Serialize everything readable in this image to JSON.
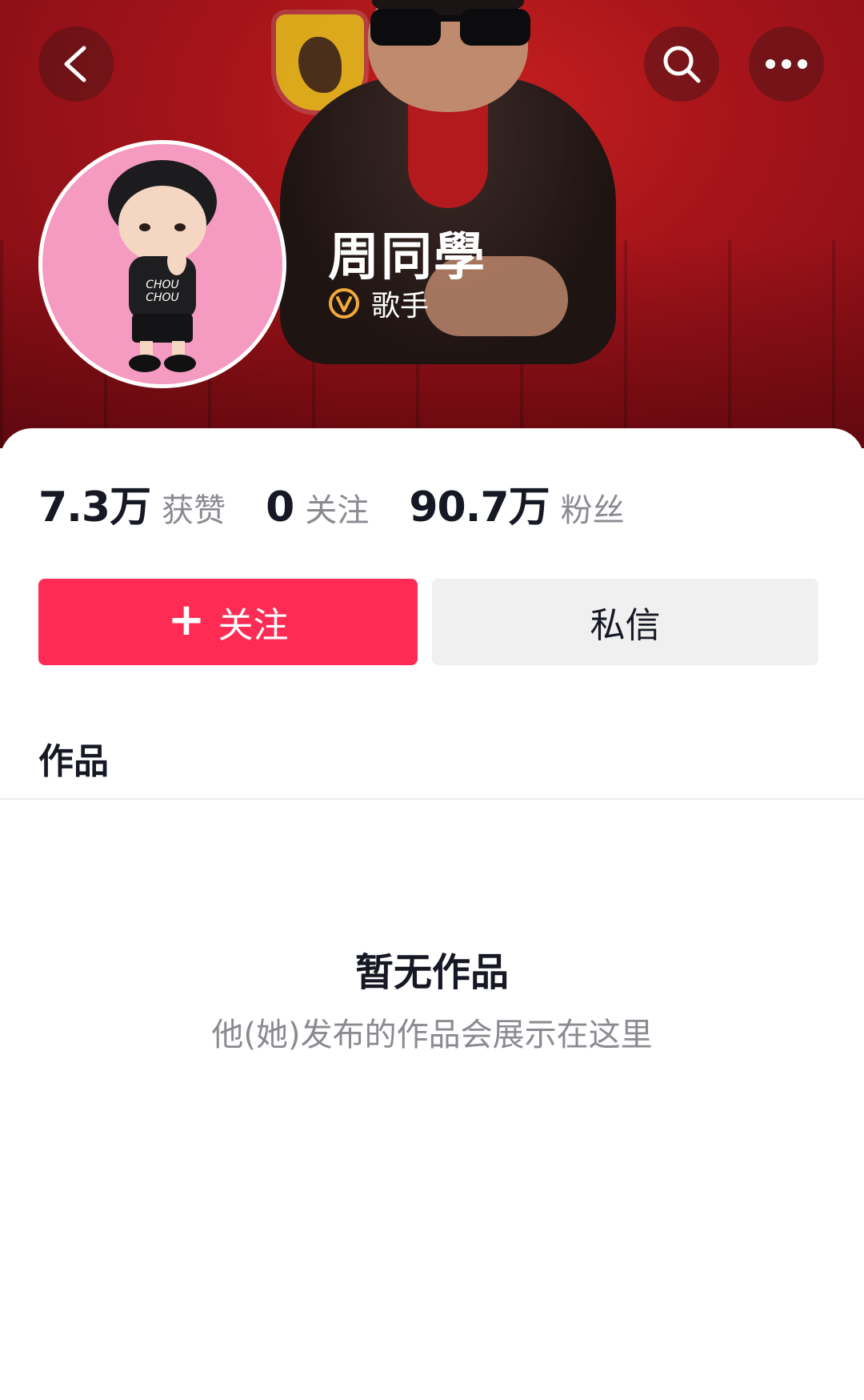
{
  "header": {
    "back_icon": "chevron-left-icon",
    "search_icon": "search-icon",
    "more_icon": "more-horizontal-icon"
  },
  "profile": {
    "name": "周同學",
    "verification_label": "歌手",
    "verification_icon": "v-badge-icon"
  },
  "stats": [
    {
      "value": "7.3万",
      "label": "获赞"
    },
    {
      "value": "0",
      "label": "关注"
    },
    {
      "value": "90.7万",
      "label": "粉丝"
    }
  ],
  "actions": {
    "follow_label": "关注",
    "follow_icon": "plus-icon",
    "message_label": "私信"
  },
  "tabs": {
    "works_label": "作品"
  },
  "empty_state": {
    "title": "暂无作品",
    "subtitle": "他(她)发布的作品会展示在这里"
  },
  "colors": {
    "accent": "#fe2c55",
    "banner": "#a5141a",
    "avatar_bg": "#f59ac1",
    "text_primary": "#161823",
    "text_secondary": "#8a8b91"
  }
}
